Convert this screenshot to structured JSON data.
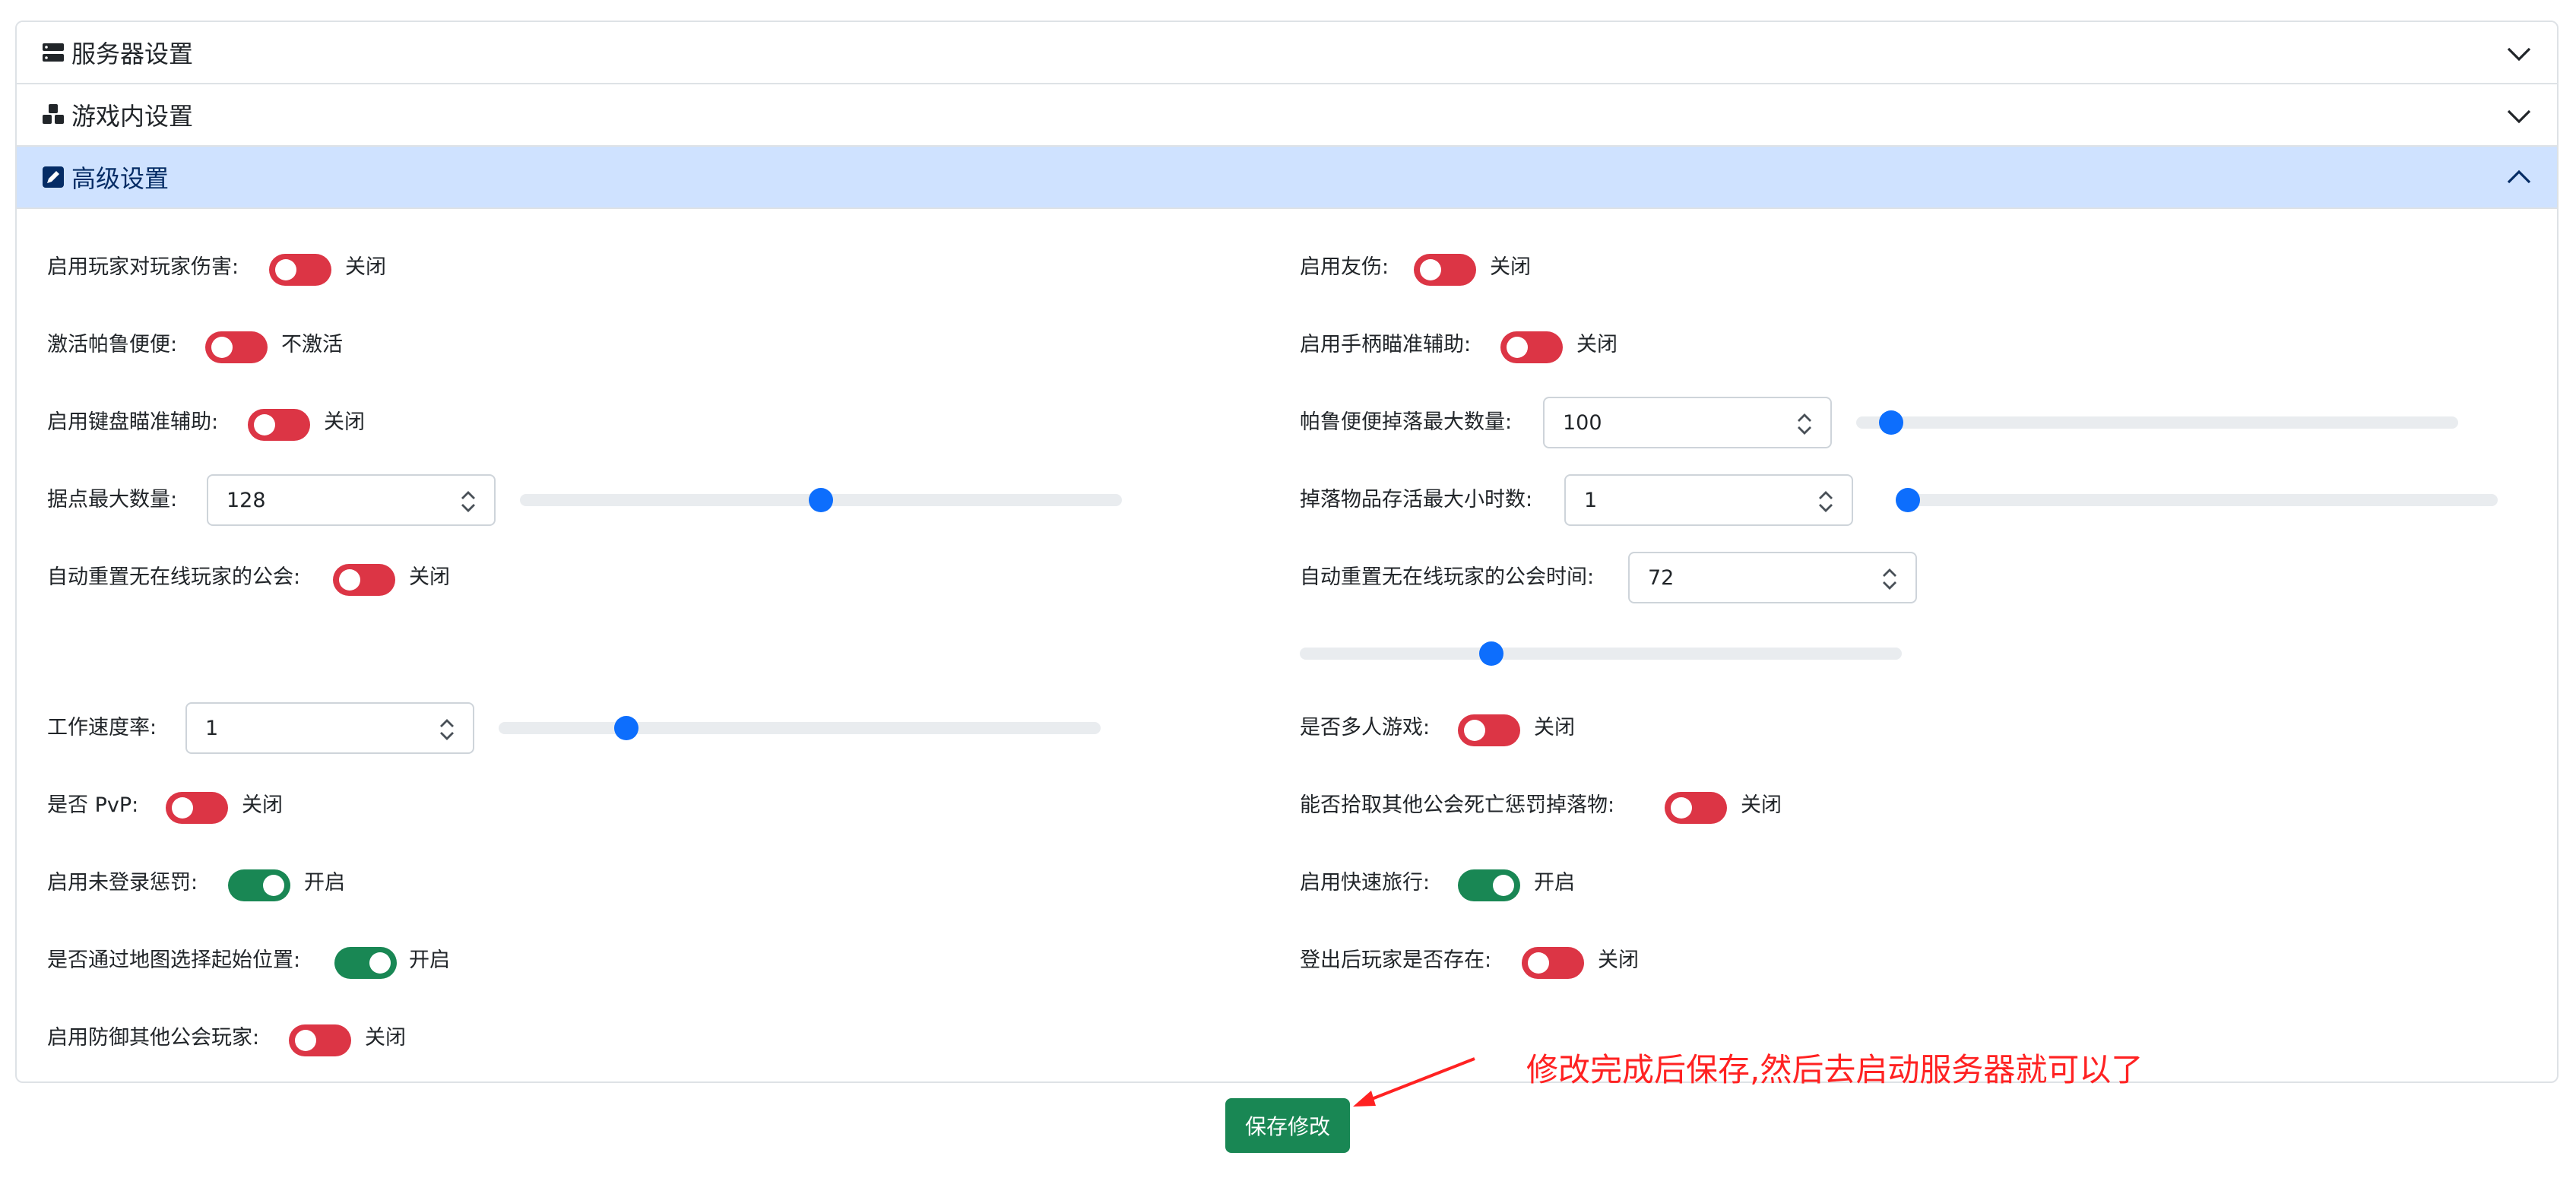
{
  "sections": {
    "server": "服务器设置",
    "ingame": "游戏内设置",
    "advanced": "高级设置"
  },
  "left": {
    "pvp_damage": {
      "label": "启用玩家对玩家伤害:",
      "state": "关闭"
    },
    "pal_box": {
      "label": "激活帕鲁便便:",
      "state": "不激活"
    },
    "kb_aim": {
      "label": "启用键盘瞄准辅助:",
      "state": "关闭"
    },
    "base_max": {
      "label": "据点最大数量:",
      "value": "128",
      "slider_fraction": 0.5
    },
    "auto_reset_guild": {
      "label": "自动重置无在线玩家的公会:",
      "state": "关闭"
    },
    "work_speed": {
      "label": "工作速度率:",
      "value": "1",
      "slider_fraction": 0.2
    },
    "is_pvp": {
      "label": "是否 PvP:",
      "state": "关闭"
    },
    "login_penalty": {
      "label": "启用未登录惩罚:",
      "state": "开启"
    },
    "map_start": {
      "label": "是否通过地图选择起始位置:",
      "state": "开启"
    },
    "defend_guild": {
      "label": "启用防御其他公会玩家:",
      "state": "关闭"
    }
  },
  "right": {
    "friendly_fire": {
      "label": "启用友伤:",
      "state": "关闭"
    },
    "pad_aim": {
      "label": "启用手柄瞄准辅助:",
      "state": "关闭"
    },
    "pal_drop_max": {
      "label": "帕鲁便便掉落最大数量:",
      "value": "100",
      "slider_fraction": 0.04
    },
    "drop_hours": {
      "label": "掉落物品存活最大小时数:",
      "value": "1",
      "slider_fraction": 0.0
    },
    "reset_time": {
      "label": "自动重置无在线玩家的公会时间:",
      "value": "72",
      "slider_fraction": 0.31
    },
    "multiplayer": {
      "label": "是否多人游戏:",
      "state": "关闭"
    },
    "pickup_drops": {
      "label": "能否拾取其他公会死亡惩罚掉落物:",
      "state": "关闭"
    },
    "fast_travel": {
      "label": "启用快速旅行:",
      "state": "开启"
    },
    "player_exists": {
      "label": "登出后玩家是否存在:",
      "state": "关闭"
    }
  },
  "save_label": "保存修改",
  "annotation": "修改完成后保存,然后去启动服务器就可以了",
  "colors": {
    "off": "#dc3545",
    "on": "#198754",
    "accent": "#0d6efd",
    "annotation": "#ff2222"
  }
}
